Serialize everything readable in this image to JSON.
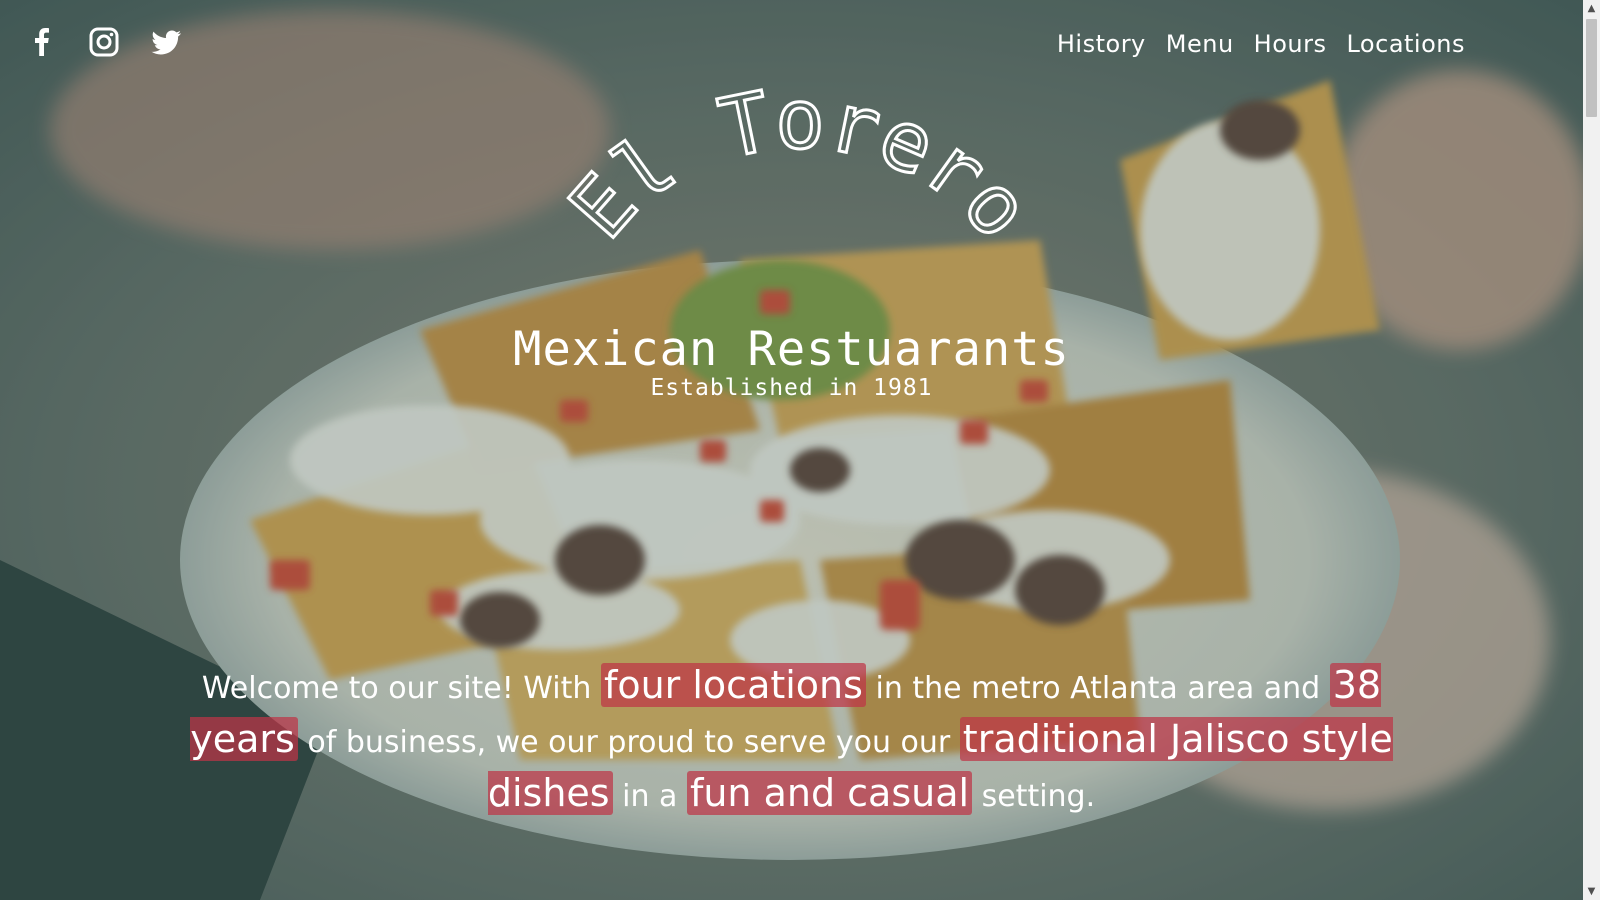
{
  "social": [
    {
      "name": "facebook",
      "icon": "facebook-icon"
    },
    {
      "name": "instagram",
      "icon": "instagram-icon"
    },
    {
      "name": "twitter",
      "icon": "twitter-icon"
    }
  ],
  "nav": {
    "items": [
      "History",
      "Menu",
      "Hours",
      "Locations"
    ]
  },
  "logo": {
    "arc_text": "El Torero",
    "subtitle": "Mexican Restuarants",
    "established": "Established in 1981"
  },
  "welcome": {
    "part1": "Welcome to our site! With ",
    "hl1": "four locations",
    "part2": " in the metro Atlanta area and ",
    "hl2": "38 years",
    "part3": " of business, we our proud to serve you our ",
    "hl3": "traditional Jalisco style dishes",
    "part4": " in a ",
    "hl4": "fun and casual",
    "part5": " setting."
  },
  "colors": {
    "highlight": "#be3446",
    "overlay": "#466460",
    "text": "#ffffff"
  },
  "scrollbar": {
    "up_icon": "chevron-up-icon",
    "down_icon": "chevron-down-icon"
  }
}
